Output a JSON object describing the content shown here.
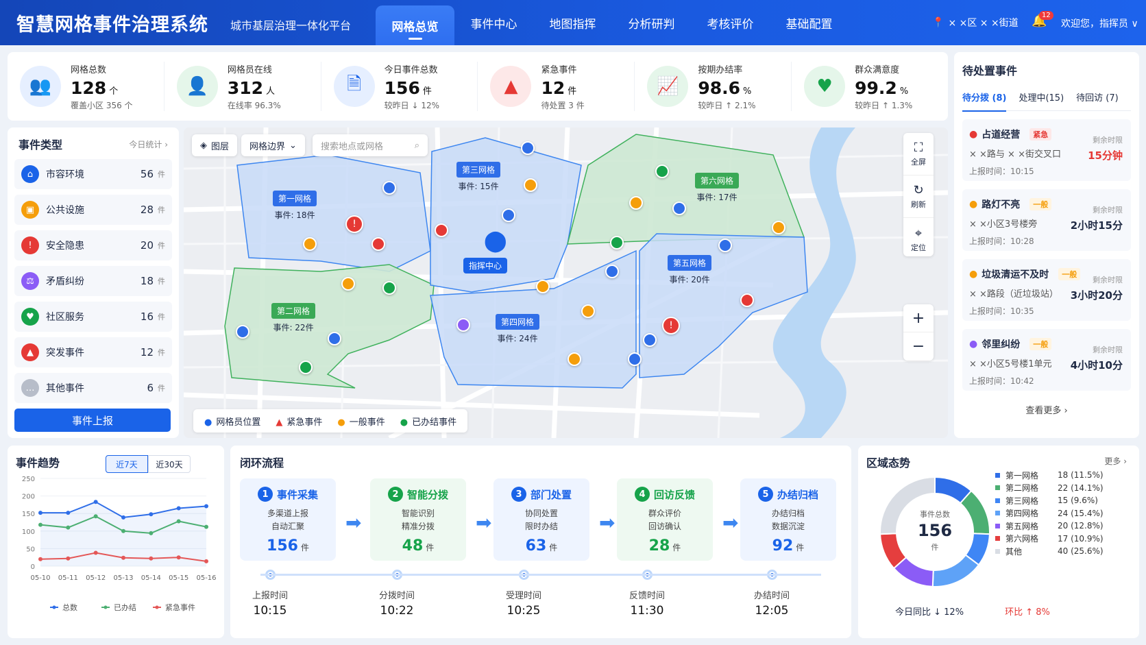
{
  "header": {
    "title": "智慧网格事件治理系统",
    "subtitle": "城市基层治理一体化平台",
    "nav": [
      "网格总览",
      "事件中心",
      "地图指挥",
      "分析研判",
      "考核评价",
      "基础配置"
    ],
    "location": "× ×区 × ×街道",
    "bell_count": "12",
    "user": "欢迎您，指挥员 ∨"
  },
  "kpis": [
    {
      "label": "网格总数",
      "value": "128",
      "unit": "个",
      "sub": "覆盖小区  356 个",
      "icon": "grid-people-icon",
      "color": "#1a63e8",
      "bg": "#e6efff"
    },
    {
      "label": "网格员在线",
      "value": "312",
      "unit": "人",
      "sub": "在线率  96.3%",
      "icon": "person-icon",
      "color": "#16a34a",
      "bg": "#e5f6ea"
    },
    {
      "label": "今日事件总数",
      "value": "156",
      "unit": "件",
      "sub": "较昨日  ↓ 12%",
      "icon": "document-icon",
      "color": "#1a63e8",
      "bg": "#e6efff"
    },
    {
      "label": "紧急事件",
      "value": "12",
      "unit": "件",
      "sub": "待处置  3 件",
      "icon": "warning-icon",
      "color": "#e53935",
      "bg": "#fde8e8"
    },
    {
      "label": "按期办结率",
      "value": "98.6",
      "unit": "%",
      "sub": "较昨日  ↑ 2.1%",
      "icon": "rising-chart-icon",
      "color": "#16a34a",
      "bg": "#e5f6ea"
    },
    {
      "label": "群众满意度",
      "value": "99.2",
      "unit": "%",
      "sub": "较昨日  ↑ 1.3%",
      "icon": "heart-icon",
      "color": "#16a34a",
      "bg": "#e5f6ea"
    }
  ],
  "types": {
    "title": "事件类型",
    "meta": "今日统计 ›",
    "unit": "件",
    "items": [
      {
        "label": "市容环境",
        "count": "56",
        "color": "#1a63e8",
        "icon": "⌂"
      },
      {
        "label": "公共设施",
        "count": "28",
        "color": "#f59e0b",
        "icon": "▣"
      },
      {
        "label": "安全隐患",
        "count": "20",
        "color": "#e53935",
        "icon": "!"
      },
      {
        "label": "矛盾纠纷",
        "count": "18",
        "color": "#8b5cf6",
        "icon": "⚖"
      },
      {
        "label": "社区服务",
        "count": "16",
        "color": "#16a34a",
        "icon": "♥"
      },
      {
        "label": "突发事件",
        "count": "12",
        "color": "#e53935",
        "icon": "▲"
      },
      {
        "label": "其他事件",
        "count": "6",
        "color": "#b7bdc9",
        "icon": "…"
      }
    ],
    "report_button": "事件上报"
  },
  "map": {
    "layer": "图层",
    "boundary": "网格边界",
    "search_placeholder": "搜索地点或网格",
    "fullscreen": "全屏",
    "refresh": "刷新",
    "locate": "定位",
    "zoom_in": "+",
    "zoom_out": "−",
    "center": "指挥中心",
    "grids": [
      {
        "name": "第一网格",
        "count": "事件: 18件"
      },
      {
        "name": "第二网格",
        "count": "事件: 22件"
      },
      {
        "name": "第三网格",
        "count": "事件: 15件"
      },
      {
        "name": "第四网格",
        "count": "事件: 24件"
      },
      {
        "name": "第五网格",
        "count": "事件: 20件"
      },
      {
        "name": "第六网格",
        "count": "事件: 17件"
      }
    ],
    "legend": [
      "网格员位置",
      "紧急事件",
      "一般事件",
      "已办结事件"
    ]
  },
  "pending": {
    "title": "待处置事件",
    "tabs": [
      "待分拨 (8)",
      "处理中(15)",
      "待回访 (7)"
    ],
    "remain_label": "剩余时限",
    "time_prefix": "上报时间：",
    "items": [
      {
        "title": "占道经营",
        "tag": "紧急",
        "addr": "× ×路与 × ×街交叉口",
        "time": "10:15",
        "remain": "15分钟",
        "color": "#e53935"
      },
      {
        "title": "路灯不亮",
        "tag": "一般",
        "addr": "× ×小区3号楼旁",
        "time": "10:28",
        "remain": "2小时15分",
        "color": "#f59e0b"
      },
      {
        "title": "垃圾清运不及时",
        "tag": "一般",
        "addr": "× ×路段（近垃圾站）",
        "time": "10:35",
        "remain": "3小时20分",
        "color": "#f59e0b"
      },
      {
        "title": "邻里纠纷",
        "tag": "一般",
        "addr": "× ×小区5号楼1单元",
        "time": "10:42",
        "remain": "4小时10分",
        "color": "#8b5cf6"
      }
    ],
    "more": "查看更多 ›"
  },
  "trend": {
    "title": "事件趋势",
    "tabs": [
      "近7天",
      "近30天"
    ]
  },
  "flow": {
    "title": "闭环流程",
    "unit": "件",
    "steps": [
      {
        "name": "事件采集",
        "d1": "多渠道上报",
        "d2": "自动汇聚",
        "value": "156",
        "color": "#1a63e8",
        "bg": "#eef4ff",
        "time_label": "上报时间",
        "time": "10:15"
      },
      {
        "name": "智能分拨",
        "d1": "智能识别",
        "d2": "精准分拨",
        "value": "48",
        "color": "#16a34a",
        "bg": "#eef9f1",
        "time_label": "分拨时间",
        "time": "10:22"
      },
      {
        "name": "部门处置",
        "d1": "协同处置",
        "d2": "限时办结",
        "value": "63",
        "color": "#1a63e8",
        "bg": "#eef4ff",
        "time_label": "受理时间",
        "time": "10:25"
      },
      {
        "name": "回访反馈",
        "d1": "群众评价",
        "d2": "回访确认",
        "value": "28",
        "color": "#16a34a",
        "bg": "#eef9f1",
        "time_label": "反馈时间",
        "time": "11:30"
      },
      {
        "name": "办结归档",
        "d1": "办结归档",
        "d2": "数据沉淀",
        "value": "92",
        "color": "#1a63e8",
        "bg": "#eef4ff",
        "time_label": "办结时间",
        "time": "12:05"
      }
    ]
  },
  "region": {
    "title": "区域态势",
    "more": "更多 ›",
    "center_label": "事件总数",
    "center_value": "156",
    "center_unit": "件",
    "yoy": "今日同比  ↓ 12%",
    "mom": "环比  ↑ 8%"
  },
  "chart_data": [
    {
      "type": "line",
      "title": "事件趋势",
      "categories": [
        "05-10",
        "05-11",
        "05-12",
        "05-13",
        "05-14",
        "05-15",
        "05-16"
      ],
      "ylim": [
        0,
        250
      ],
      "yticks": [
        0,
        50,
        100,
        150,
        200,
        250
      ],
      "series": [
        {
          "name": "总数",
          "color": "#2f6ee8",
          "values": [
            152,
            152,
            183,
            139,
            148,
            165,
            171
          ]
        },
        {
          "name": "已办结",
          "color": "#4caf72",
          "values": [
            118,
            110,
            142,
            100,
            94,
            128,
            112
          ]
        },
        {
          "name": "紧急事件",
          "color": "#e45757",
          "values": [
            20,
            22,
            38,
            24,
            22,
            25,
            14
          ]
        }
      ]
    },
    {
      "type": "pie",
      "title": "区域态势",
      "series": [
        {
          "name": "第一网格",
          "value": 18,
          "label": "18 (11.5%)",
          "color": "#2f6ee8"
        },
        {
          "name": "第二网格",
          "value": 22,
          "label": "22 (14.1%)",
          "color": "#4caf72"
        },
        {
          "name": "第三网格",
          "value": 15,
          "label": "15   (9.6%)",
          "color": "#3f86f5"
        },
        {
          "name": "第四网格",
          "value": 24,
          "label": "24 (15.4%)",
          "color": "#5ea2f7"
        },
        {
          "name": "第五网格",
          "value": 20,
          "label": "20 (12.8%)",
          "color": "#8b5cf6"
        },
        {
          "name": "第六网格",
          "value": 17,
          "label": "17 (10.9%)",
          "color": "#e53e3e"
        },
        {
          "name": "其他",
          "value": 40,
          "label": "40 (25.6%)",
          "color": "#d9dde4"
        }
      ]
    }
  ]
}
